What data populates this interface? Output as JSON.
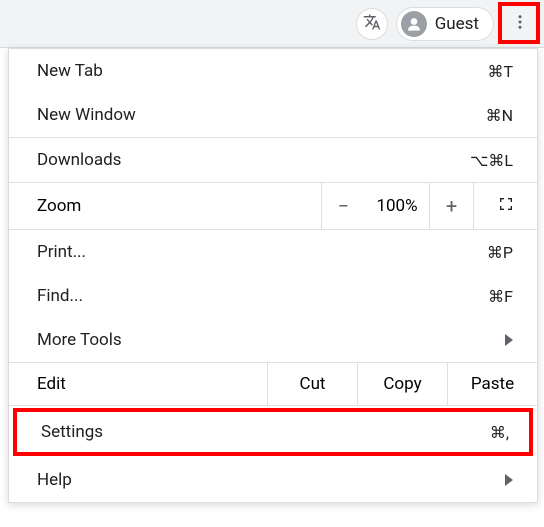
{
  "toolbar": {
    "guest_label": "Guest"
  },
  "menu": {
    "new_tab": {
      "label": "New Tab",
      "shortcut": "⌘T"
    },
    "new_window": {
      "label": "New Window",
      "shortcut": "⌘N"
    },
    "downloads": {
      "label": "Downloads",
      "shortcut": "⌥⌘L"
    },
    "zoom": {
      "label": "Zoom",
      "minus": "−",
      "value": "100%",
      "plus": "+"
    },
    "print": {
      "label": "Print...",
      "shortcut": "⌘P"
    },
    "find": {
      "label": "Find...",
      "shortcut": "⌘F"
    },
    "more_tools": {
      "label": "More Tools"
    },
    "edit": {
      "label": "Edit",
      "cut": "Cut",
      "copy": "Copy",
      "paste": "Paste"
    },
    "settings": {
      "label": "Settings",
      "shortcut": "⌘,"
    },
    "help": {
      "label": "Help"
    }
  }
}
